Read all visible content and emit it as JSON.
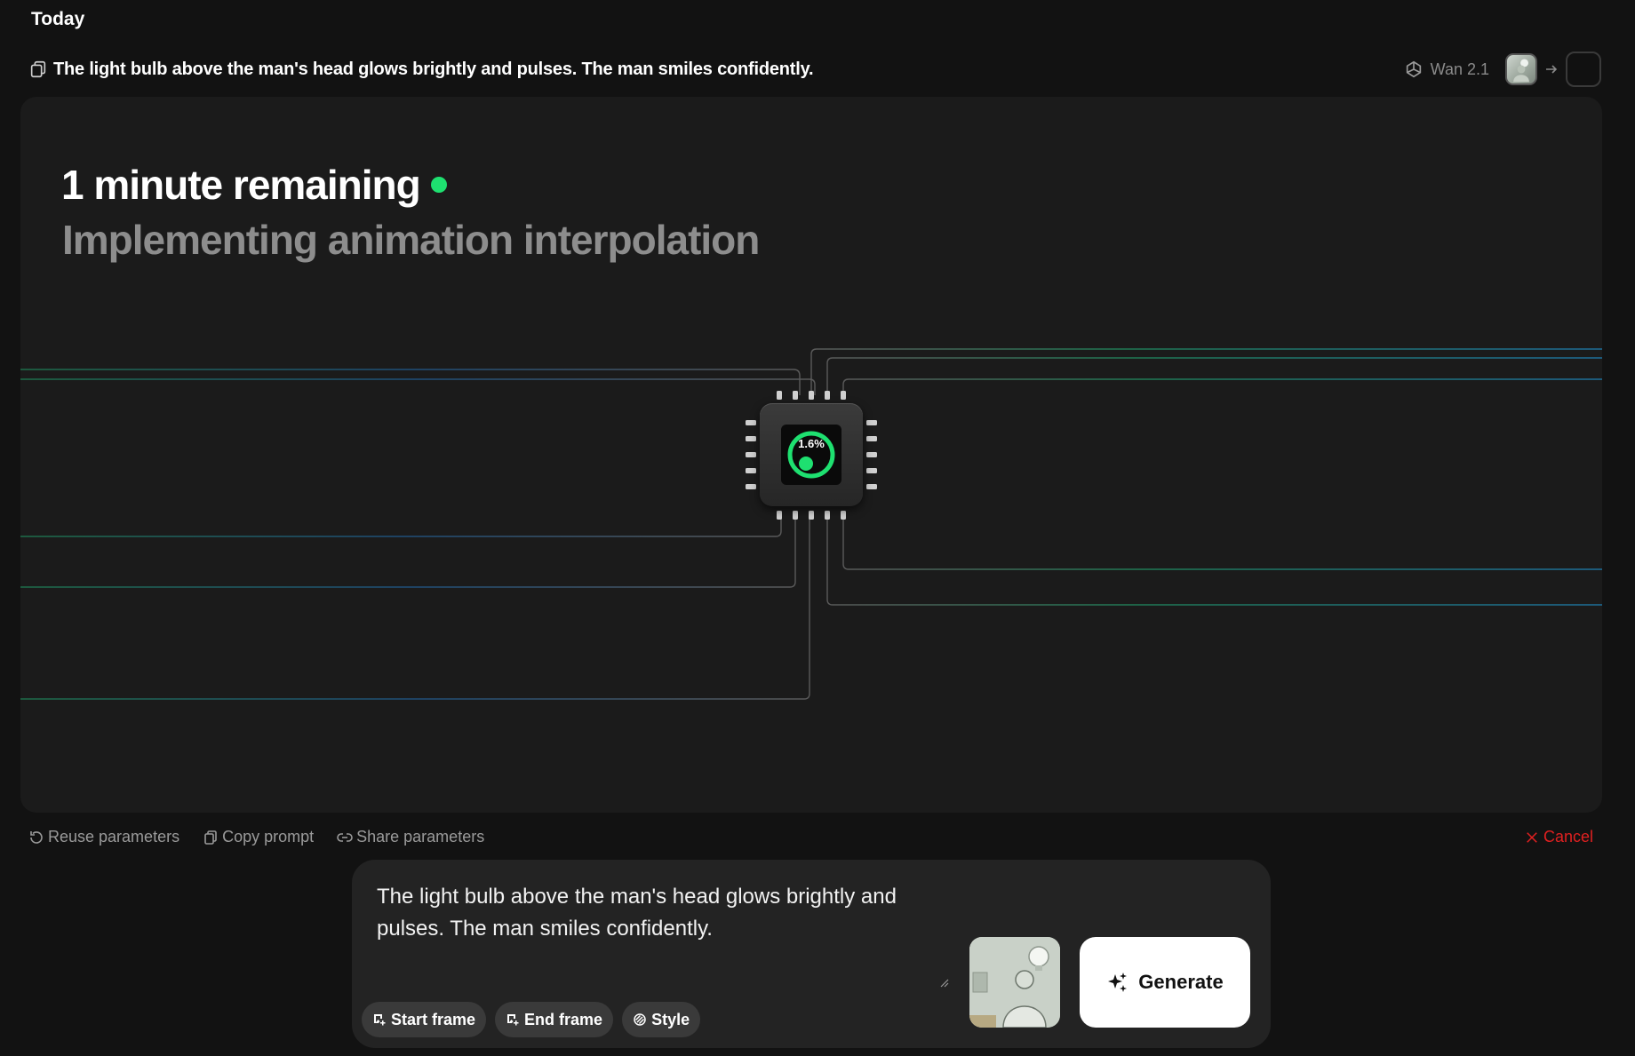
{
  "section_label": "Today",
  "prompt": {
    "title": "The light bulb above the man's head glows brightly and pulses. The man smiles confidently.",
    "model": "Wan 2.1"
  },
  "progress": {
    "remaining": "1 minute remaining",
    "stage": "Implementing animation interpolation",
    "percent_label": "1.6%",
    "percent_value": 1.6
  },
  "actions": {
    "reuse": "Reuse parameters",
    "copy": "Copy prompt",
    "share": "Share parameters",
    "cancel": "Cancel"
  },
  "composer": {
    "text": "The light bulb above the man's head glows brightly and pulses. The man smiles confidently.",
    "start_frame": "Start frame",
    "end_frame": "End frame",
    "style": "Style",
    "generate": "Generate"
  },
  "colors": {
    "accent_green": "#1ee070",
    "cancel_red": "#e02020",
    "background": "#121212",
    "panel": "#1b1b1b"
  }
}
